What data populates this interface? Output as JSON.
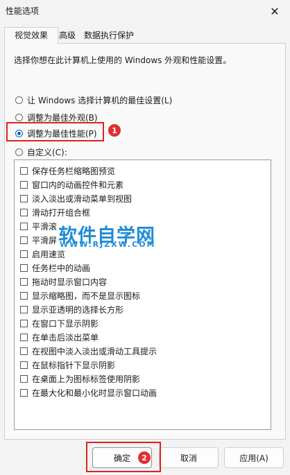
{
  "window": {
    "title": "性能选项",
    "close_glyph": "✕"
  },
  "tabs": [
    {
      "label": "视觉效果",
      "active": true
    },
    {
      "label": "高级"
    },
    {
      "label": "数据执行保护"
    }
  ],
  "description": "选择你想在此计算机上使用的 Windows 外观和性能设置。",
  "radio_options": [
    {
      "label": "让 Windows 选择计算机的最佳设置(L)",
      "selected": false
    },
    {
      "label": "调整为最佳外观(B)",
      "selected": false
    },
    {
      "label": "调整为最佳性能(P)",
      "selected": true
    },
    {
      "label": "自定义(C):",
      "selected": false
    }
  ],
  "effects": [
    "保存任务栏缩略图预览",
    "窗口内的动画控件和元素",
    "淡入淡出或滑动菜单到视图",
    "滑动打开组合框",
    "平滑滚动列表框",
    "平滑屏幕字体边缘",
    "启用速览",
    "任务栏中的动画",
    "拖动时显示窗口内容",
    "显示缩略图，而不是显示图标",
    "显示亚透明的选择长方形",
    "在窗口下显示阴影",
    "在单击后淡出菜单",
    "在视图中淡入淡出或滑动工具提示",
    "在鼠标指针下显示阴影",
    "在桌面上为图标标签使用阴影",
    "在最大化和最小化时显示窗口动画"
  ],
  "effects_visible": [
    "保存任务栏缩略图预览",
    "窗口内的动画控件和元素",
    "淡入淡出或滑动菜单到视图",
    "滑动打开组合框",
    "平滑滚",
    "平滑屏",
    "启用速览",
    "任务栏中的动画",
    "拖动时显示窗口内容",
    "显示缩略图，而不是显示图标",
    "显示亚透明的选择长方形",
    "在窗口下显示阴影",
    "在单击后淡出菜单",
    "在视图中淡入淡出或滑动工具提示",
    "在鼠标指针下显示阴影",
    "在桌面上为图标标签使用阴影",
    "在最大化和最小化时显示窗口动画"
  ],
  "watermark": {
    "main": "软件自学网",
    "sub": "WWW.RJZXW.COM"
  },
  "annotations": {
    "step1": "1",
    "step2": "2",
    "color": "#e02020"
  },
  "buttons": {
    "ok": "确定",
    "cancel": "取消",
    "apply": "应用(A)"
  }
}
